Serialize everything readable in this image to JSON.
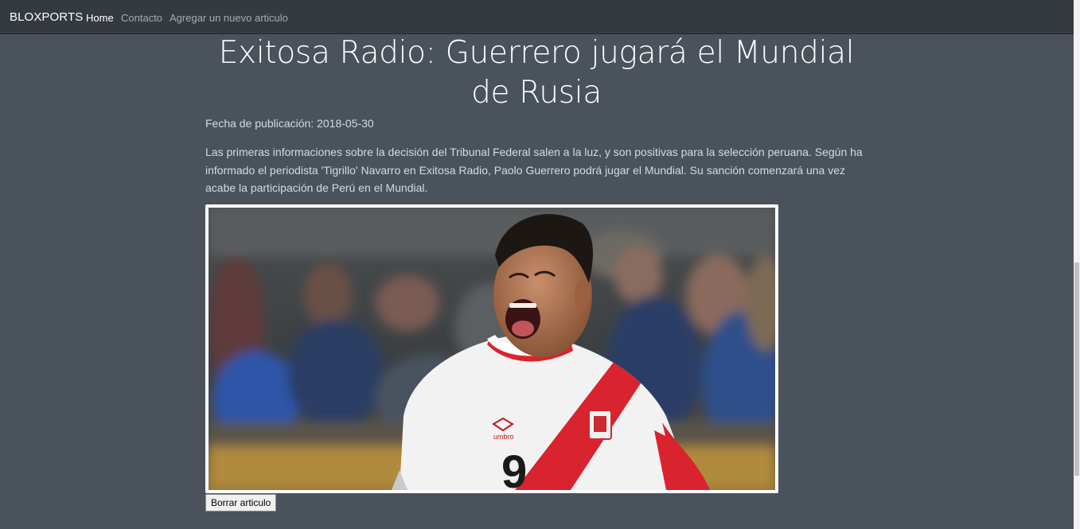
{
  "navbar": {
    "brand": "BLOXPORTS",
    "links": [
      {
        "label": "Home",
        "active": true
      },
      {
        "label": "Contacto",
        "active": false
      },
      {
        "label": "Agregar un nuevo articulo",
        "active": false
      }
    ]
  },
  "article": {
    "title": "Exitosa Radio: Guerrero jugará el Mundial de Rusia",
    "date_label": "Fecha de publicación: 2018-05-30",
    "body": "Las primeras informaciones sobre la decisión del Tribunal Federal salen a la luz, y son positivas para la selección peruana. Según ha informado el periodista 'Tigrillo' Navarro en Exitosa Radio, Paolo Guerrero podrá jugar el Mundial. Su sanción comenzará una vez acabe la participación de Perú en el Mundial.",
    "image": {
      "jersey_number": "9",
      "jersey_brand": "umbro"
    },
    "delete_button": "Borrar articulo"
  },
  "colors": {
    "page_background": "#4a525c",
    "navbar_background": "#343a40",
    "jersey_red": "#d9232e"
  }
}
